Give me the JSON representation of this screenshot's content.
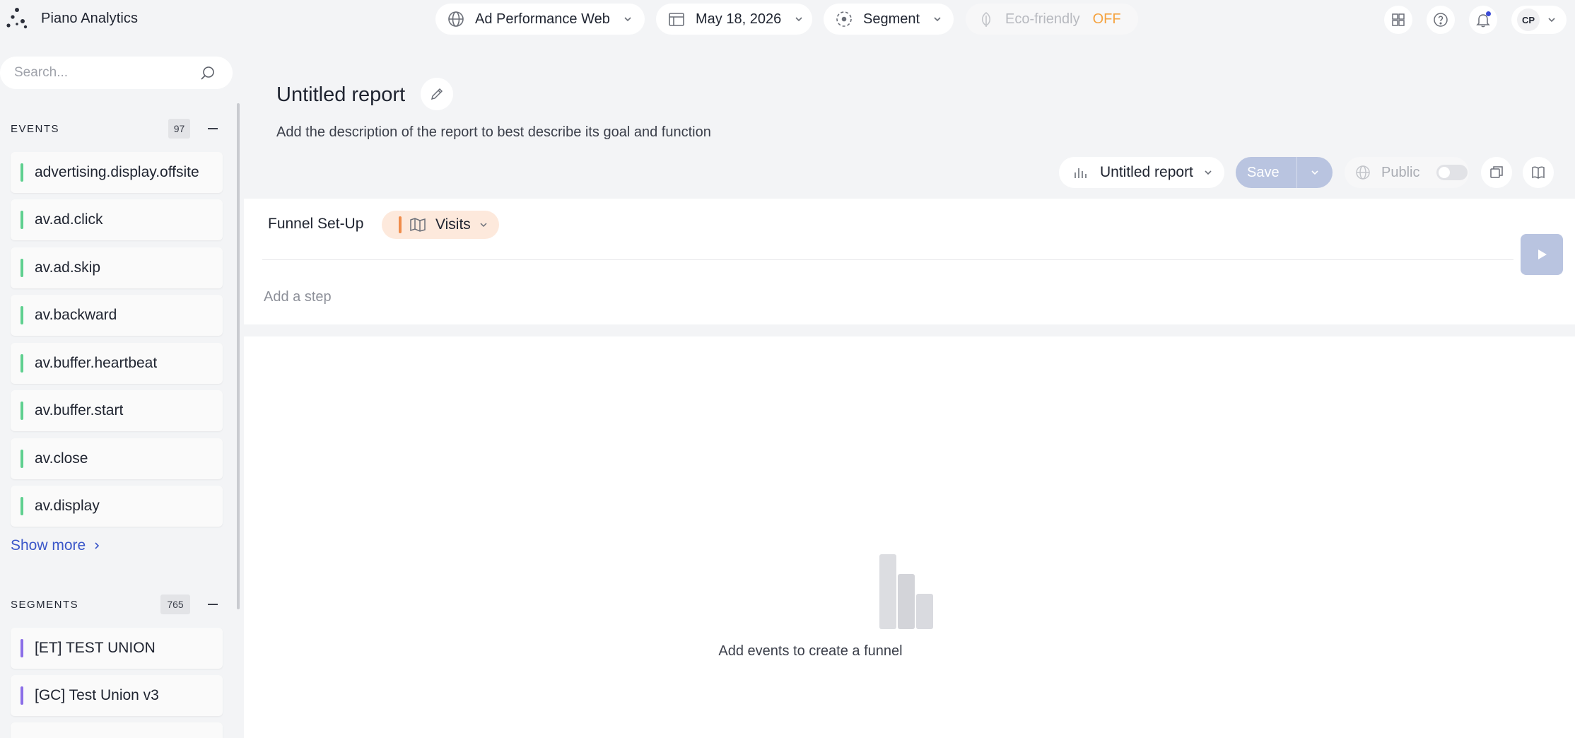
{
  "app": {
    "title": "Piano Analytics"
  },
  "topbar": {
    "site": "Ad Performance Web",
    "date": "May 18, 2026",
    "segment": "Segment",
    "eco_label": "Eco-friendly",
    "eco_state": "OFF",
    "avatar_initials": "CP"
  },
  "sidebar": {
    "search_placeholder": "Search...",
    "events": {
      "title": "EVENTS",
      "count": "97",
      "items": [
        "advertising.display.offsite",
        "av.ad.click",
        "av.ad.skip",
        "av.backward",
        "av.buffer.heartbeat",
        "av.buffer.start",
        "av.close",
        "av.display"
      ],
      "show_more": "Show more"
    },
    "segments": {
      "title": "SEGMENTS",
      "count": "765",
      "items": [
        "[ET] TEST UNION",
        "[GC] Test Union v3"
      ]
    }
  },
  "report": {
    "title": "Untitled report",
    "description": "Add the description of the report to best describe its goal and function",
    "selector_label": "Untitled report",
    "save_label": "Save",
    "public_label": "Public"
  },
  "funnel": {
    "setup_label": "Funnel Set-Up",
    "metric": "Visits",
    "add_step": "Add a step",
    "empty_message": "Add events to create a funnel"
  },
  "colors": {
    "accent": "#3b57c9",
    "event_bar": "#5fd08f",
    "segment_bar": "#8b6ee8",
    "metric_bar": "#f08c4a",
    "eco_off": "#f5a340",
    "disabled_primary": "#b9c4e0"
  }
}
